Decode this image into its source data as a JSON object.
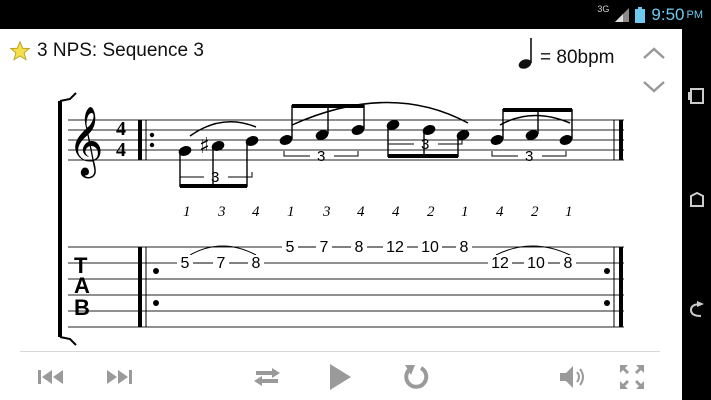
{
  "status": {
    "network": "3G",
    "time": "9:50",
    "ampm": "PM"
  },
  "header": {
    "title": "3 NPS: Sequence 3",
    "tempo": "= 80bpm"
  },
  "score": {
    "time_signature": [
      "4",
      "4"
    ],
    "tuplet_label": "3",
    "tuplets": [
      "3",
      "3",
      "3",
      "3"
    ],
    "fingerings": [
      "1",
      "3",
      "4",
      "1",
      "3",
      "4",
      "4",
      "2",
      "1",
      "4",
      "2",
      "1"
    ],
    "tab_clef": [
      "T",
      "A",
      "B"
    ],
    "tab_group1": [
      "5",
      "7",
      "8"
    ],
    "tab_group2": [
      "5",
      "7",
      "8",
      "12",
      "10",
      "8"
    ],
    "tab_group3": [
      "12",
      "10",
      "8"
    ]
  },
  "controls": {
    "icons": [
      "skip-back-icon",
      "skip-forward-icon",
      "loop-icon",
      "play-icon",
      "replay-icon",
      "volume-icon",
      "fullscreen-icon"
    ]
  }
}
